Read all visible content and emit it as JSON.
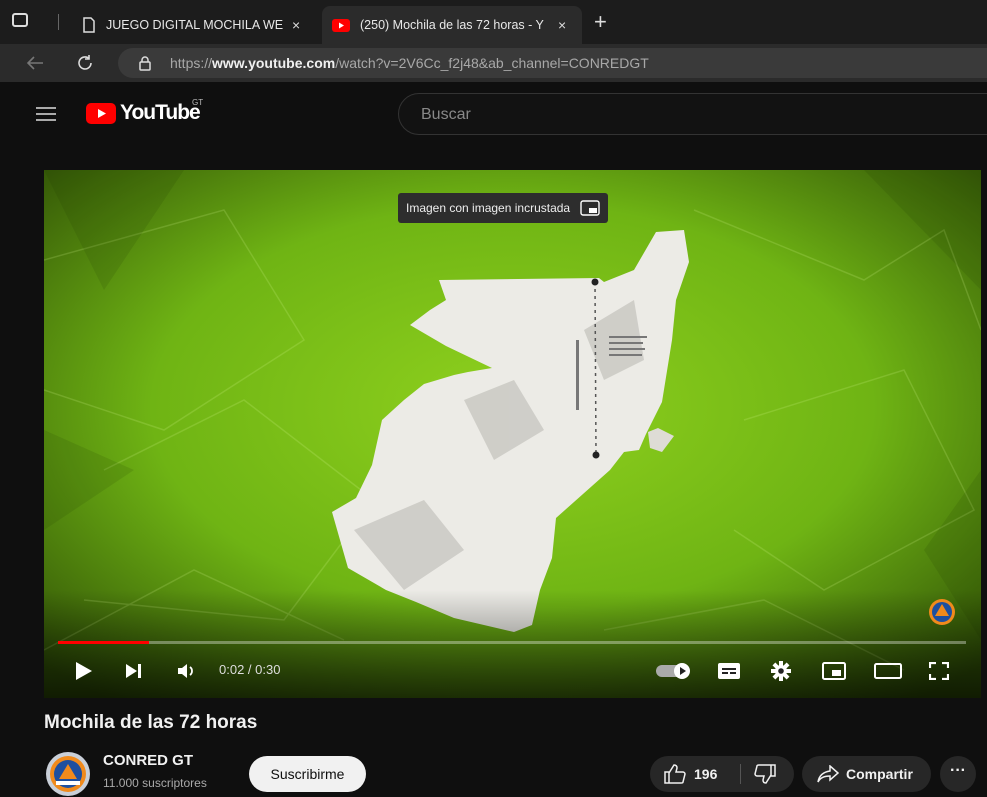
{
  "browser": {
    "tabs": [
      {
        "title": "JUEGO DIGITAL MOCHILA WEB (",
        "close": "×",
        "active": false
      },
      {
        "title": "(250) Mochila de las 72 horas - Y",
        "close": "×",
        "active": true
      }
    ],
    "new_tab": "+",
    "url_prefix": "https://",
    "url_host": "www.youtube.com",
    "url_path": "/watch?v=2V6Cc_f2j48&ab_channel=CONREDGT"
  },
  "youtube": {
    "logo_text": "YouTube",
    "country": "GT",
    "search_placeholder": "Buscar",
    "brand_color": "#ff0000"
  },
  "video": {
    "tooltip": "Imagen con imagen incrustada",
    "time": "0:02 / 0:30",
    "progress_fraction": 0.1
  },
  "details": {
    "title": "Mochila de las 72 horas",
    "channel": "CONRED GT",
    "subscribers": "11.000 suscriptores",
    "subscribe_label": "Suscribirme",
    "likes": "196",
    "share_label": "Compartir",
    "more": "···"
  }
}
